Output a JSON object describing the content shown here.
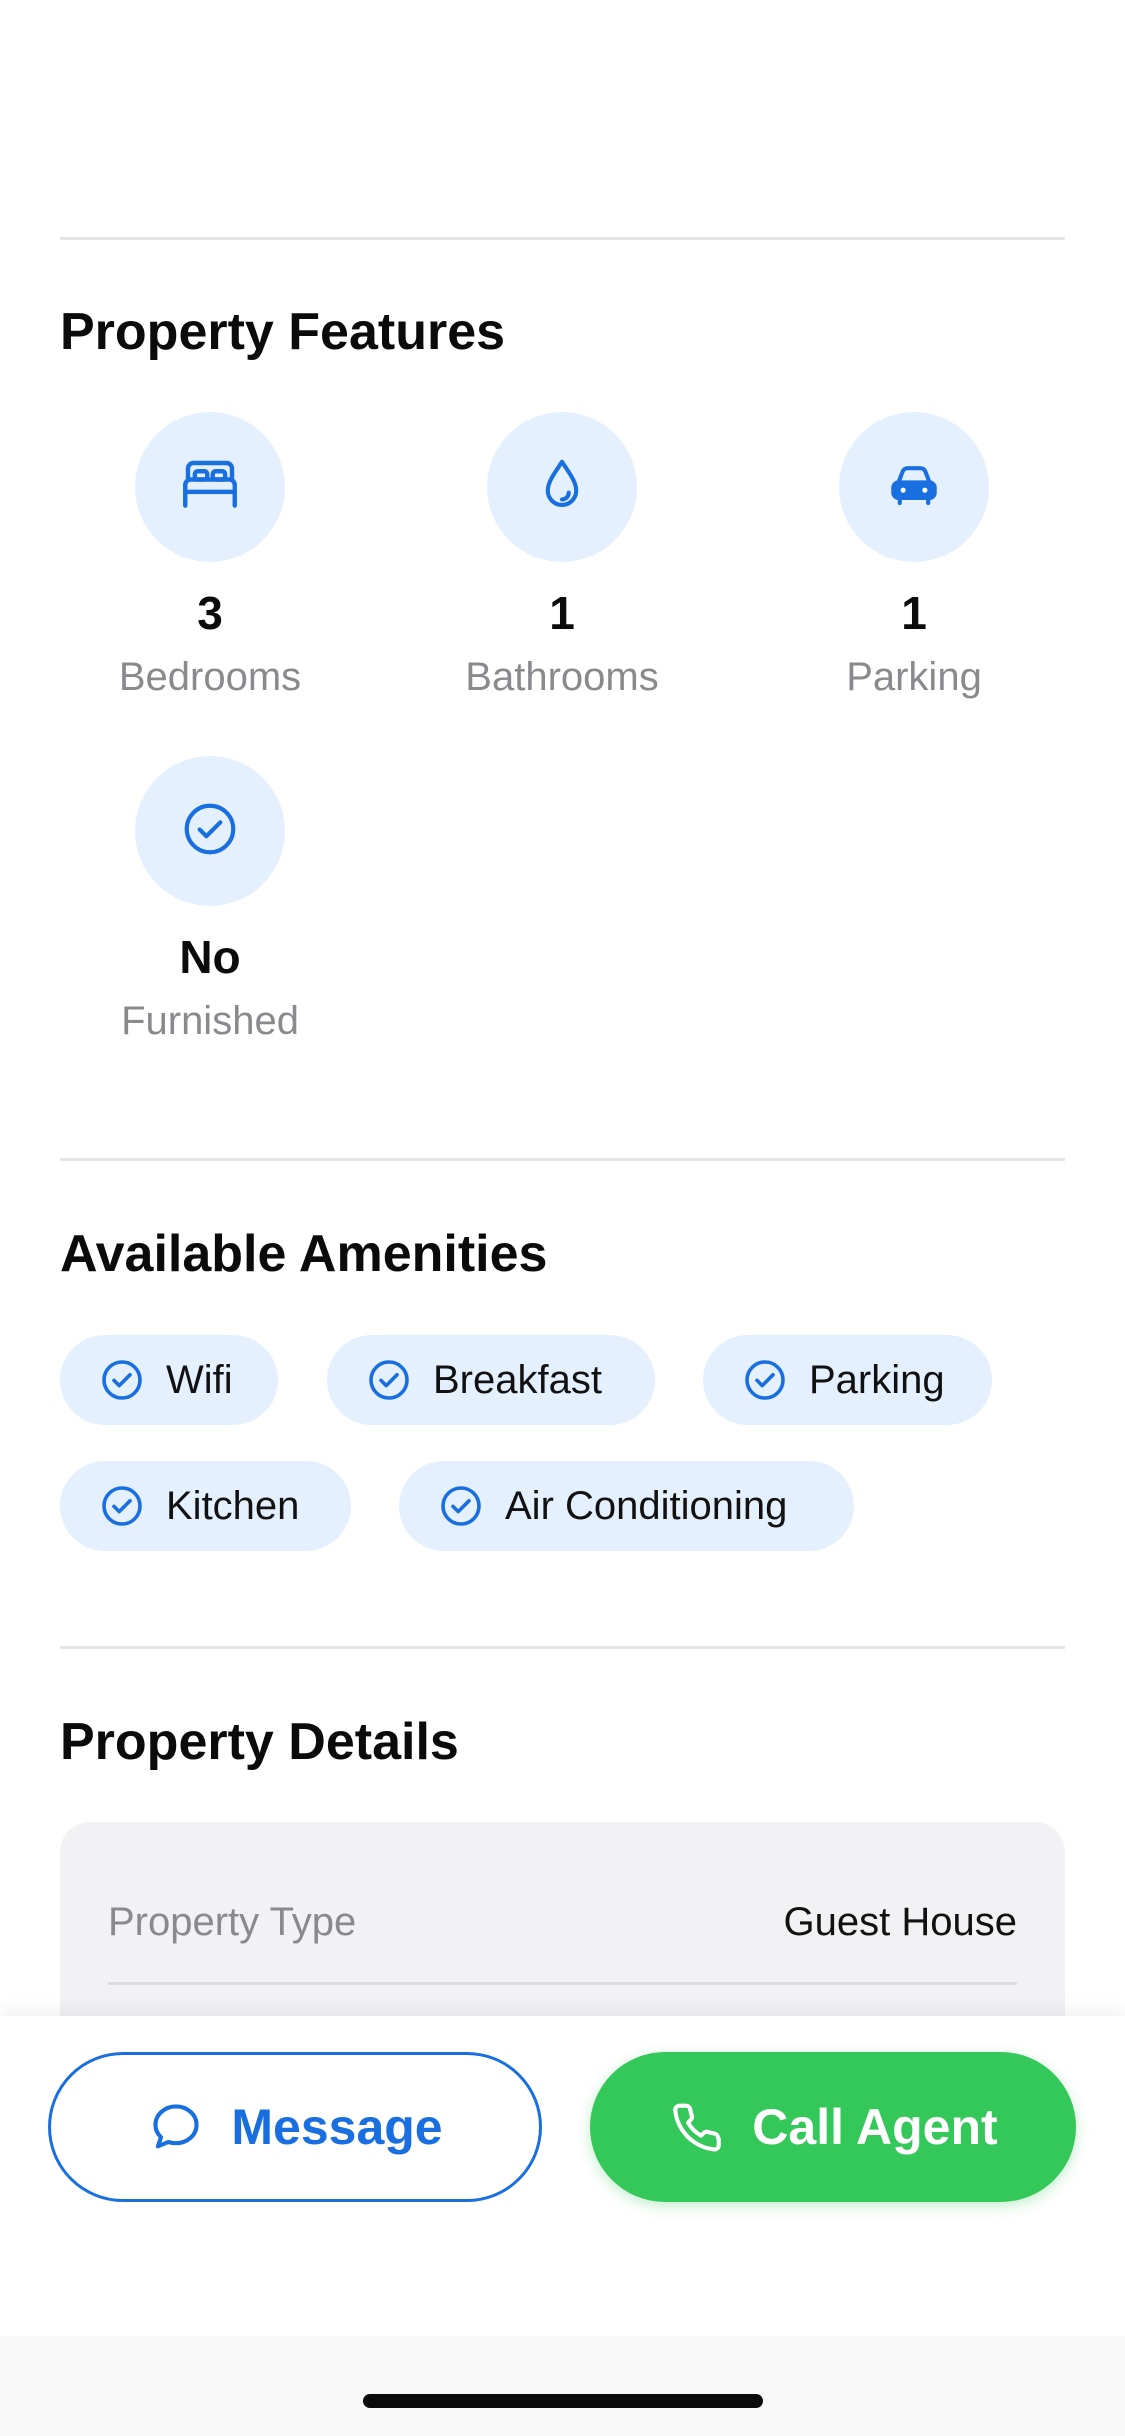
{
  "features_section": {
    "title": "Property Features",
    "items": [
      {
        "icon": "bed-icon",
        "value": "3",
        "label": "Bedrooms"
      },
      {
        "icon": "water-drop-icon",
        "value": "1",
        "label": "Bathrooms"
      },
      {
        "icon": "car-icon",
        "value": "1",
        "label": "Parking"
      },
      {
        "icon": "check-circle-icon",
        "value": "No",
        "label": "Furnished"
      }
    ]
  },
  "amenities_section": {
    "title": "Available Amenities",
    "items": [
      "Wifi",
      "Breakfast",
      "Parking",
      "Kitchen",
      "Air Conditioning"
    ]
  },
  "details_section": {
    "title": "Property Details",
    "rows": [
      {
        "key": "Property Type",
        "value": "Guest House"
      }
    ]
  },
  "actions": {
    "message_label": "Message",
    "call_label": "Call Agent"
  },
  "colors": {
    "accent": "#1a6fe0",
    "call_green": "#34c759",
    "icon_bg": "#e4f0fe",
    "muted_text": "#8a8a8e"
  }
}
